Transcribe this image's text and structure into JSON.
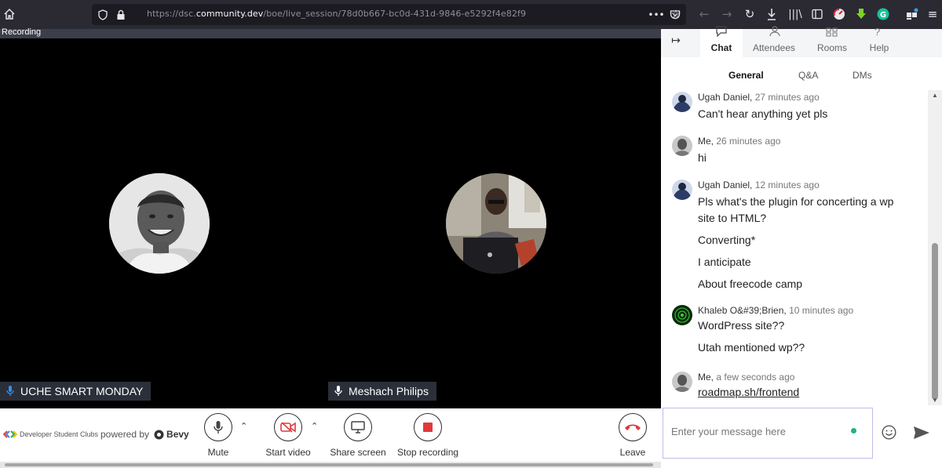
{
  "browser": {
    "url_prefix": "https://dsc.",
    "url_domain": "community.dev",
    "url_path": "/boe/live_session/78d0b667-bc0d-431d-9846-e5292f4e82f9"
  },
  "stage": {
    "recording_label": "Recording",
    "participants": [
      {
        "name": "UCHE SMART MONDAY"
      },
      {
        "name": "Meshach Philips"
      }
    ]
  },
  "toolbar": {
    "brand": "Developer Student Clubs",
    "powered_by": "powered by",
    "bevy": "Bevy",
    "mute": "Mute",
    "start_video": "Start video",
    "share_screen": "Share screen",
    "stop_recording": "Stop recording",
    "leave": "Leave"
  },
  "panel": {
    "tabs": {
      "chat": "Chat",
      "attendees": "Attendees",
      "rooms": "Rooms",
      "help": "Help"
    },
    "subtabs": {
      "general": "General",
      "qa": "Q&A",
      "dms": "DMs"
    },
    "messages": [
      {
        "author": "Ugah Daniel,",
        "time": "27 minutes ago",
        "lines": [
          "Can't hear anything yet pls"
        ]
      },
      {
        "author": "Me,",
        "time": "26 minutes ago",
        "lines": [
          "hi"
        ]
      },
      {
        "author": "Ugah Daniel,",
        "time": "12 minutes ago",
        "lines": [
          "Pls what's the plugin for concerting a wp",
          "site to HTML?",
          "Converting*",
          "I anticipate",
          "About freecode camp"
        ]
      },
      {
        "author": "Khaleb O&#39;Brien,",
        "time": "10 minutes ago",
        "lines": [
          "WordPress site??",
          "Utah mentioned wp??"
        ]
      },
      {
        "author": "Me,",
        "time": "a few seconds ago",
        "lines": [
          "roadmap.sh/frontend"
        ]
      }
    ],
    "input_placeholder": "Enter your message here"
  },
  "colors": {
    "leave_red": "#e0393e",
    "stop_red": "#e0393e",
    "brand_blue": "#2f67d8",
    "online_green": "#1bb87a"
  }
}
